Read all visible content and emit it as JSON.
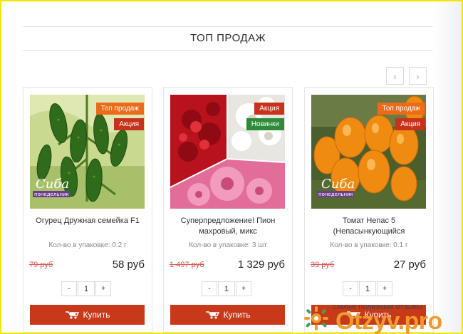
{
  "section": {
    "title": "ТОП ПРОДАЖ",
    "prev_icon": "chevron-left-icon",
    "next_icon": "chevron-right-icon",
    "prev_glyph": "‹",
    "next_glyph": "›"
  },
  "products": [
    {
      "name": "Огурец Дружная семейка F1",
      "pack": "Кол-во в упаковке: 0.2 г",
      "old_price": "79 руб",
      "price": "58 руб",
      "qty": "1",
      "badges": [
        "Топ продаж",
        "Акция"
      ],
      "brand_logo": "Сиба Понедельник",
      "buy_label": "Купить"
    },
    {
      "name": "Суперпредложение! Пион махровый, микс",
      "pack": "Кол-во в упаковке: 3 шт",
      "old_price": "1 497 руб",
      "price": "1 329 руб",
      "qty": "1",
      "badges": [
        "Акция",
        "Новинки"
      ],
      "buy_label": "Купить"
    },
    {
      "name": "Томат Непас 5 (Непасынкующийся",
      "pack": "Кол-во в упаковке: 0.1 г",
      "old_price": "39 руб",
      "price": "27 руб",
      "qty": "1",
      "badges": [
        "Топ продаж",
        "Акция"
      ],
      "brand_logo": "Сиба Понедельник",
      "buy_label": "Купить"
    }
  ],
  "qty_controls": {
    "minus": "-",
    "plus": "+"
  },
  "watermark": {
    "caption": "самые полезные отзывы",
    "name": "Otzyv.pro",
    "icon": "otzyv-logo-icon"
  },
  "colors": {
    "badge_top": "#ec6b1a",
    "badge_sale": "#c8321a",
    "badge_new": "#2e8b3a",
    "buy_button": "#c8391a",
    "old_price": "#d9534f",
    "watermark": "#f09a2d"
  }
}
